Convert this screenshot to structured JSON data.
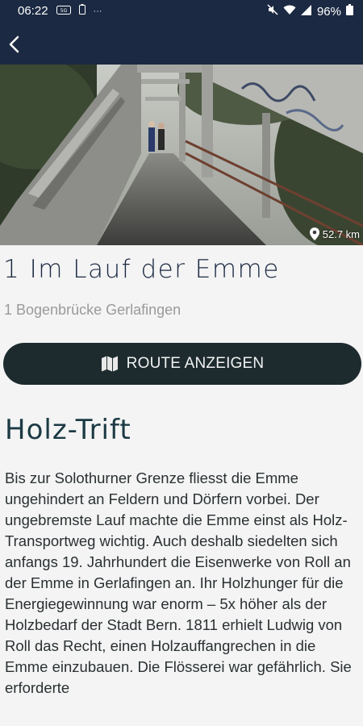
{
  "status_bar": {
    "time": "06:22",
    "dots": "···",
    "battery": "96%"
  },
  "colors": {
    "header_bg": "#1b2942",
    "button_bg": "#1d2b2f",
    "title": "#1b2942"
  },
  "hero": {
    "distance": "52.7 km"
  },
  "stop": {
    "title": "1 Im Lauf der Emme",
    "subtitle": "1 Bogenbrücke Gerlafingen"
  },
  "route_button": {
    "label": "ROUTE ANZEIGEN",
    "icon": "map-icon"
  },
  "section": {
    "heading": "Holz-Trift",
    "body": "Bis zur Solothurner Grenze fliesst die Emme ungehindert an Feldern und Dörfern vorbei. Der ungebremste Lauf machte die Emme einst als Holz-Transportweg wichtig. Auch deshalb siedelten sich anfangs 19. Jahrhundert die Eisenwerke von Roll an der Emme in Gerlafingen an. Ihr Holzhunger für die Energiegewinnung war enorm – 5x höher als der Holzbedarf der Stadt Bern. 1811 erhielt Ludwig von Roll das Recht, einen Holzauffangrechen in die Emme einzubauen. Die Flösserei war gefährlich. Sie erforderte"
  }
}
